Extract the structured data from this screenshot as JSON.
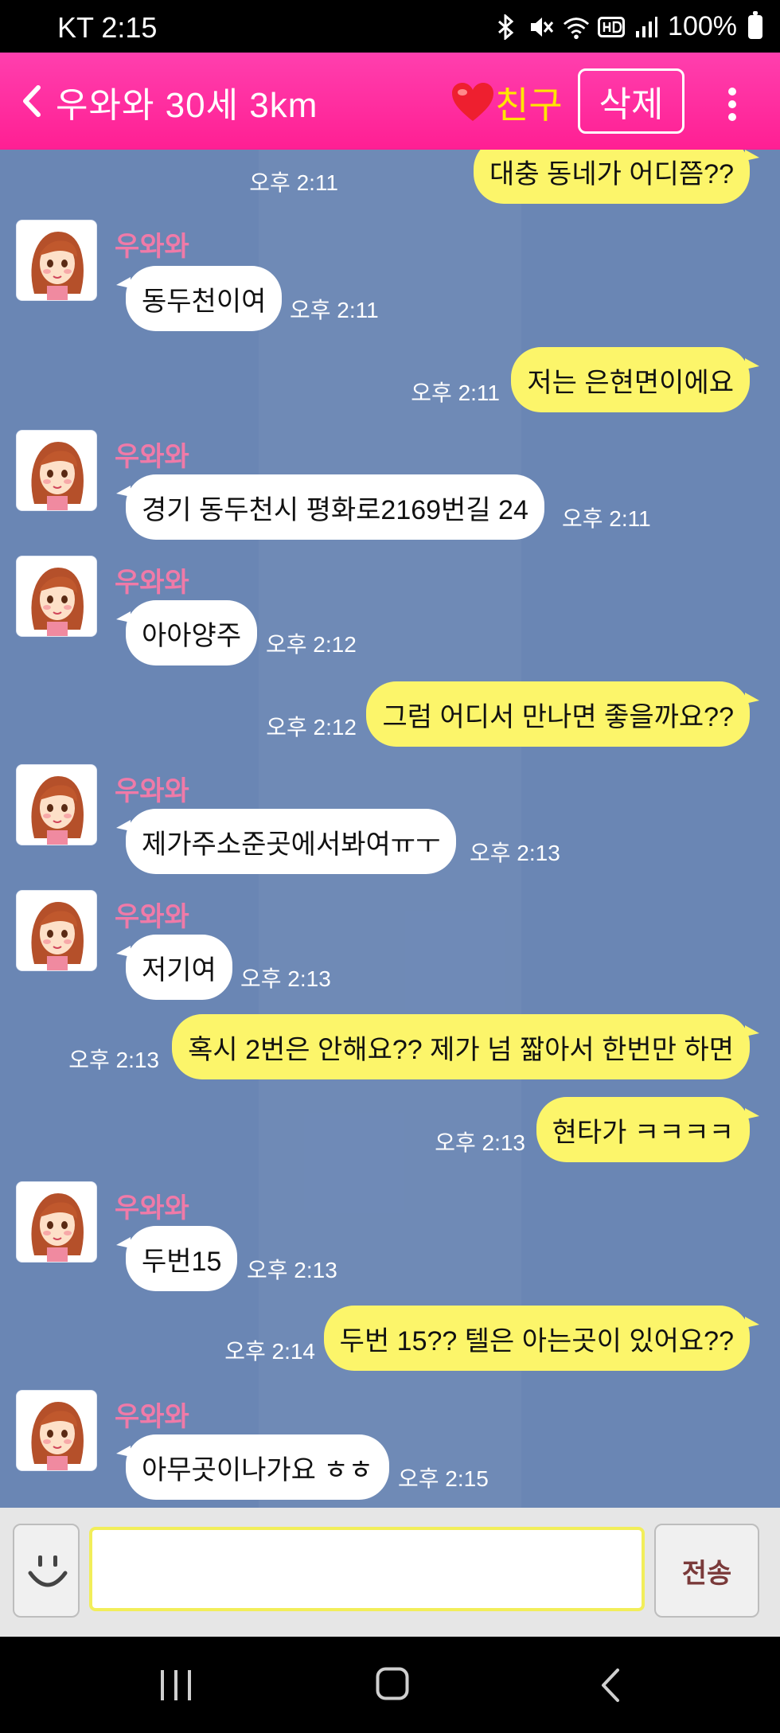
{
  "status_bar": {
    "carrier_time": "KT 2:15",
    "battery": "100%",
    "icons": [
      "bluetooth-icon",
      "mute-icon",
      "wifi-icon",
      "hd-icon",
      "signal-icon",
      "battery-icon"
    ]
  },
  "header": {
    "title": "우와와 30세 3km",
    "friend_label": "친구",
    "delete_label": "삭제",
    "colors": {
      "bar": "#ff2a9c",
      "friend": "#ffe600",
      "heart": "#ee1f2f"
    }
  },
  "chat": {
    "colors": {
      "background": "#6a86b4",
      "outgoing": "#fcf56a",
      "incoming": "#ffffff",
      "nickname": "#f07aa8"
    },
    "messages": [
      {
        "side": "out",
        "text": "대충 동네가 어디쯤??",
        "time": "오후 2:11"
      },
      {
        "side": "in",
        "sender": "우와와",
        "text": "동두천이여",
        "time": "오후 2:11"
      },
      {
        "side": "out",
        "text": "저는 은현면이에요",
        "time": "오후 2:11"
      },
      {
        "side": "in",
        "sender": "우와와",
        "text": "경기 동두천시 평화로2169번길 24",
        "time": "오후 2:11"
      },
      {
        "side": "in",
        "sender": "우와와",
        "text": "아아양주",
        "time": "오후 2:12"
      },
      {
        "side": "out",
        "text": "그럼 어디서 만나면 좋을까요??",
        "time": "오후 2:12"
      },
      {
        "side": "in",
        "sender": "우와와",
        "text": "제가주소준곳에서봐여ㅠㅜ",
        "time": "오후 2:13"
      },
      {
        "side": "in",
        "sender": "우와와",
        "text": "저기여",
        "time": "오후 2:13"
      },
      {
        "side": "out",
        "text": "혹시 2번은 안해요?? 제가 넘 짧아서 한번만 하면",
        "time": "오후 2:13"
      },
      {
        "side": "out",
        "text": "현타가 ㅋㅋㅋㅋ",
        "time": "오후 2:13"
      },
      {
        "side": "in",
        "sender": "우와와",
        "text": "두번15",
        "time": "오후 2:13"
      },
      {
        "side": "out",
        "text": "두번 15?? 텔은 아는곳이 있어요??",
        "time": "오후 2:14"
      },
      {
        "side": "in",
        "sender": "우와와",
        "text": "아무곳이나가요 ㅎㅎ",
        "time": "오후 2:15"
      }
    ]
  },
  "input_bar": {
    "placeholder": "",
    "value": "",
    "send_label": "전송"
  }
}
